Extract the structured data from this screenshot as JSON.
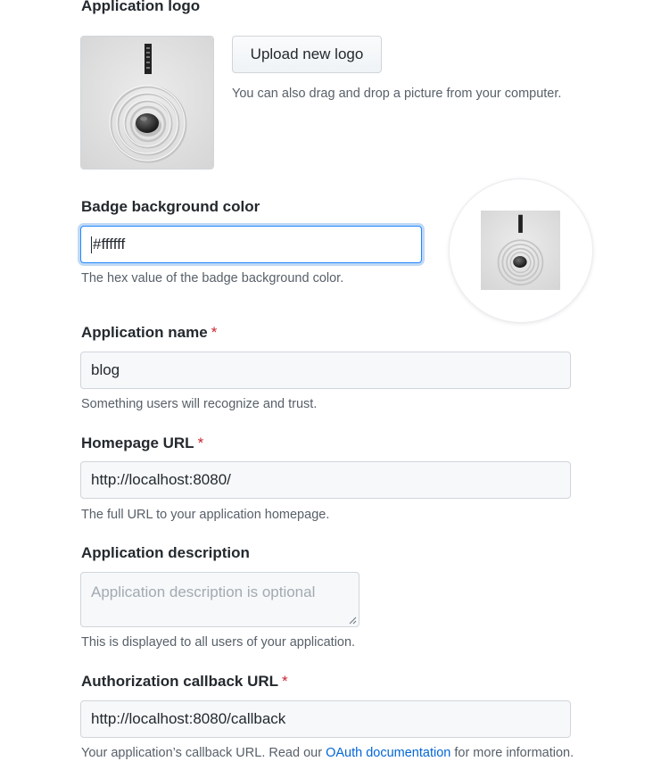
{
  "logo_section": {
    "label": "Application logo",
    "upload_button": "Upload new logo",
    "drag_hint": "You can also drag and drop a picture from your computer."
  },
  "badge": {
    "label": "Badge background color",
    "value": "#ffffff",
    "note": "The hex value of the badge background color."
  },
  "app_name": {
    "label": "Application name",
    "required_mark": "*",
    "value": "blog",
    "note": "Something users will recognize and trust."
  },
  "homepage": {
    "label": "Homepage URL",
    "required_mark": "*",
    "value": "http://localhost:8080/",
    "note": "The full URL to your application homepage."
  },
  "description": {
    "label": "Application description",
    "placeholder": "Application description is optional",
    "note": "This is displayed to all users of your application."
  },
  "callback": {
    "label": "Authorization callback URL",
    "required_mark": "*",
    "value": "http://localhost:8080/callback",
    "note_before": "Your application’s callback URL. Read our ",
    "note_link": "OAuth documentation",
    "note_after": " for more information."
  },
  "colors": {
    "link": "#0366d6",
    "required": "#cb2431",
    "focus": "#2188ff"
  }
}
